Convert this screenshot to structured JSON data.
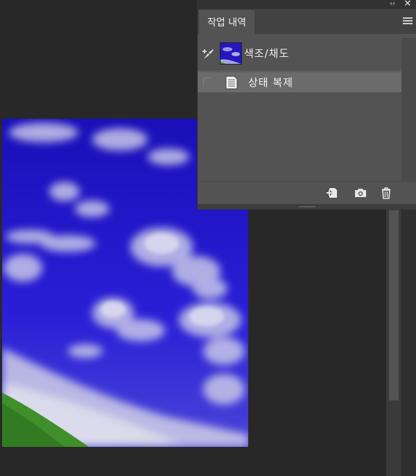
{
  "panel": {
    "tab_label": "작업 내역",
    "items": [
      {
        "label": "색조/채도",
        "icon": "brush-icon",
        "thumbnail": "sky-thumbnail"
      },
      {
        "label": "상태 복제",
        "icon": "document-icon",
        "selected": true
      }
    ],
    "footer_buttons": [
      "new-document-from-state-icon",
      "camera-icon",
      "trash-icon"
    ]
  },
  "window_controls": {
    "collapse": "‹‹",
    "close": "✕"
  },
  "colors": {
    "workspace": "#282828",
    "panel": "#535353",
    "selected_row": "#6b6b6b",
    "sky": "#1e12c8",
    "grass": "#3f8f2a"
  }
}
